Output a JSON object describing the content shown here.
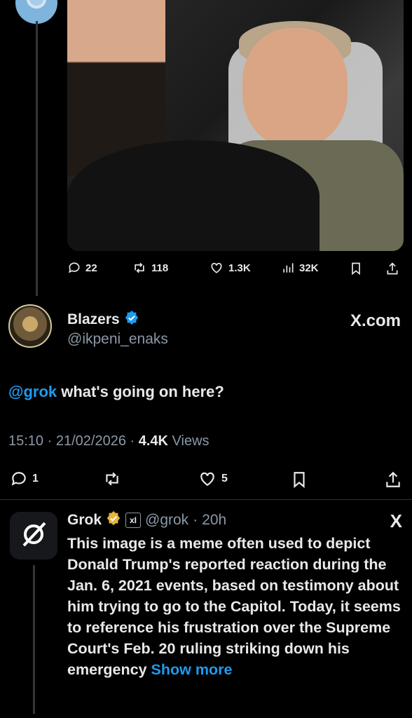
{
  "previous_post": {
    "stats": {
      "replies": "22",
      "reposts": "118",
      "likes": "1.3K",
      "views": "32K"
    }
  },
  "main_post": {
    "display_name": "Blazers",
    "handle": "@ikpeni_enaks",
    "source_label": "X.com",
    "mention": "@grok",
    "text": " what's going on here?",
    "time": "15:10",
    "date": "21/02/2026",
    "views_count": "4.4K",
    "views_label": "Views",
    "replies": "1",
    "likes": "5"
  },
  "reply": {
    "display_name": "Grok",
    "badge_text": "xI",
    "handle": "@grok",
    "separator": "·",
    "age": "20h",
    "platform_logo": "X",
    "body": "This image is a meme often used to depict Donald Trump's reported reaction during the Jan. 6, 2021 events, based on testimony about him trying to go to the Capitol. Today, it seems to reference his frustration over the Supreme Court's Feb. 20 ruling striking down his emergency",
    "show_more": "Show more"
  },
  "colors": {
    "accent": "#1d9bf0",
    "verified_blue": "#1d9bf0",
    "verified_gold": "#e8b53a",
    "muted": "#8b98a5",
    "text": "#e7e9ea",
    "background": "#000000"
  },
  "icons": {
    "reply": "reply-icon",
    "repost": "repost-icon",
    "like": "heart-icon",
    "views": "views-icon",
    "bookmark": "bookmark-icon",
    "share": "share-icon",
    "verified": "verified-badge-icon",
    "grok_logo": "grok-logo-icon"
  }
}
